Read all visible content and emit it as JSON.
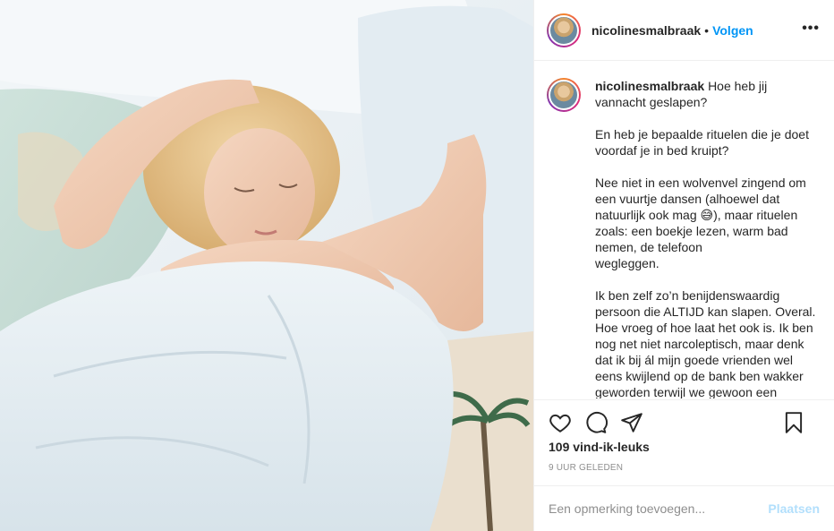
{
  "post": {
    "username": "nicolinesmalbraak",
    "separator": "•",
    "follow_label": "Volgen",
    "more_label": "•••",
    "caption_paragraphs": [
      "Hoe heb jij vannacht geslapen?",
      "En heb je bepaalde rituelen die je doet voordaf je in bed kruipt?",
      "Nee niet in een wolvenvel zingend om een vuurtje dansen (alhoewel dat natuurlijk ook mag 😅), maar rituelen zoals: een boekje lezen, warm bad nemen, de telefoon\nwegleggen.",
      "Ik ben zelf zo’n benijdenswaardig persoon die ALTIJD kan slapen. Overal. Hoe vroeg of hoe laat het ook is. Ik ben nog net niet narcoleptisch, maar denk dat ik bij ál mijn goede vrienden wel eens kwijlend op de bank ben wakker geworden terwijl we gewoon een"
    ],
    "likes": "109 vind-ik-leuks",
    "time_ago": "9 UUR GELEDEN",
    "comment_placeholder": "Een opmerking toevoegen...",
    "post_button": "Plaatsen"
  },
  "icons": [
    "heart-icon",
    "comment-icon",
    "share-icon",
    "bookmark-icon"
  ],
  "colors": {
    "link_blue": "#0095f6",
    "post_disabled": "#b2dffc",
    "border": "#efefef",
    "muted": "#8e8e8e"
  }
}
